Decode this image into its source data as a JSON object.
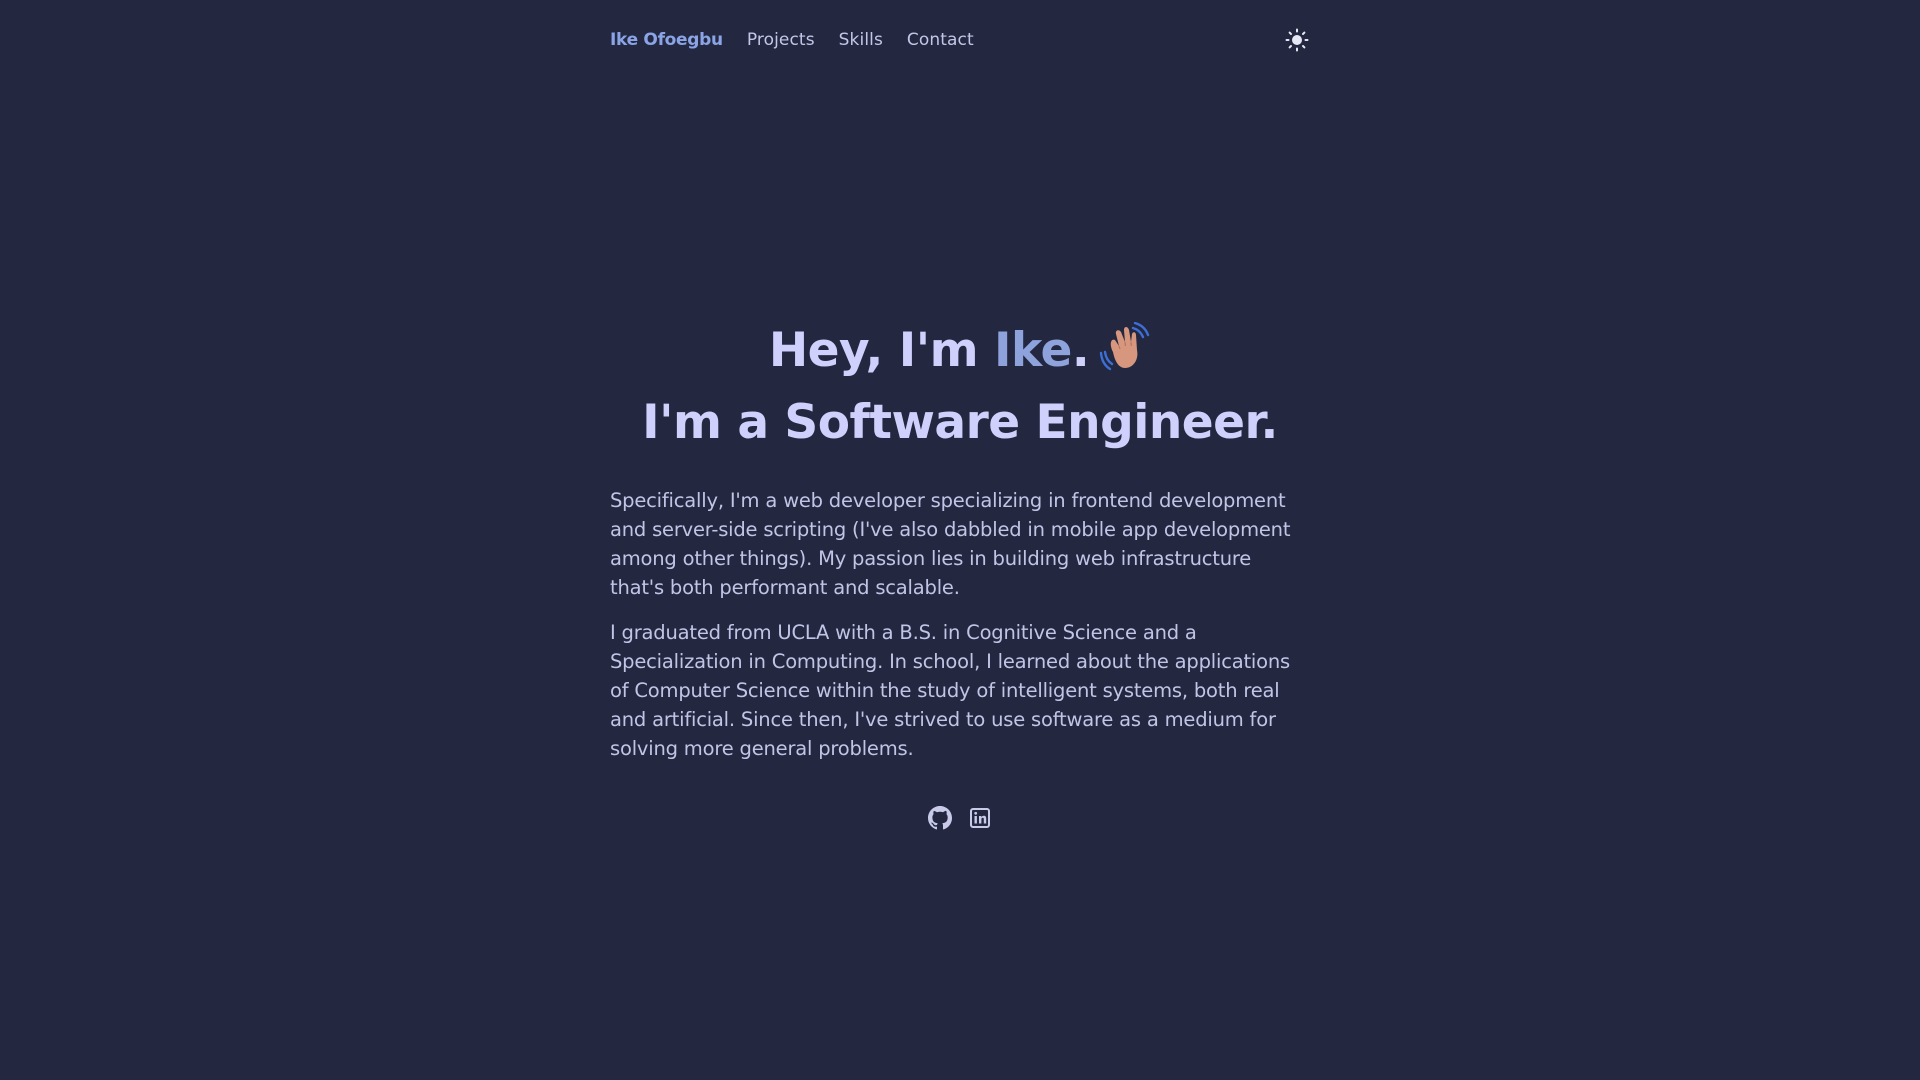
{
  "nav": {
    "brand": "Ike Ofoegbu",
    "links": [
      "Projects",
      "Skills",
      "Contact"
    ],
    "theme_toggle_icon": "sun-icon"
  },
  "hero": {
    "greeting_prefix": "Hey, I'm",
    "name": "Ike",
    "greeting_suffix": ".",
    "wave_icon": "waving-hand-icon",
    "line2": "I'm a Software Engineer."
  },
  "bio": {
    "paragraphs": [
      "Specifically, I'm a web developer specializing in frontend development and server-side scripting (I've also dabbled in mobile app development among other things). My passion lies in building web infrastructure that's both performant and scalable.",
      "I graduated from UCLA with a B.S. in Cognitive Science and a Specialization in Computing. In school, I learned about the applications of Computer Science within the study of intelligent systems, both real and artificial. Since then, I've strived to use software as a medium for solving more general problems."
    ]
  },
  "social": {
    "icons": [
      "github-icon",
      "linkedin-icon"
    ]
  },
  "colors": {
    "background": "#232840",
    "accent": "#8aa4e6",
    "heading": "#cfd0fb",
    "text": "#c2c4e6"
  }
}
